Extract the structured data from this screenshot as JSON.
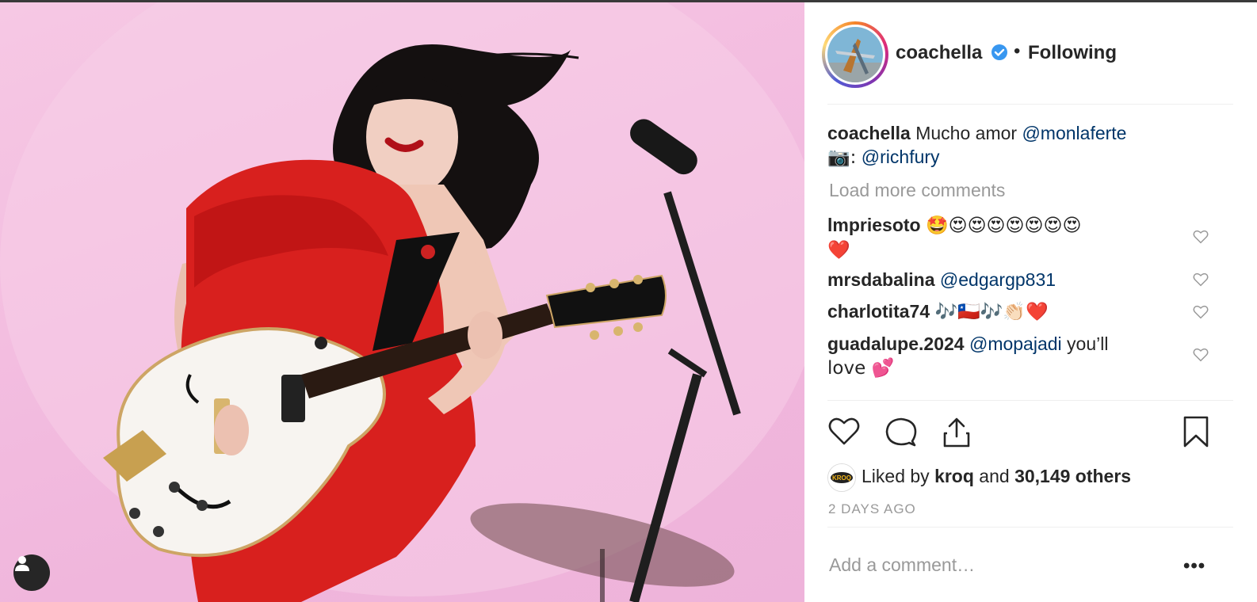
{
  "post": {
    "username": "coachella",
    "following_label": "Following",
    "separator": "•"
  },
  "caption": {
    "username": "coachella",
    "text": "Mucho amor",
    "mention": "@monlaferte",
    "credit_prefix": "📷:",
    "credit_mention": "@richfury"
  },
  "load_more": "Load more comments",
  "comments": [
    {
      "username": "lmpriesoto",
      "text": "🤩😍😍😍😍😍😍😍",
      "text2": "❤️"
    },
    {
      "username": "mrsdabalina",
      "mention": "@edgargp831"
    },
    {
      "username": "charlotita74",
      "text": "🎶🇨🇱🎶👏🏻❤️"
    },
    {
      "username": "guadalupe.2024",
      "mention": "@mopajadi",
      "text": "you’ll",
      "text2": "love 💕"
    }
  ],
  "likes": {
    "prefix": "Liked by",
    "user": "kroq",
    "conjunction": "and",
    "count": "30,149 others",
    "avatar_label": "KROQ"
  },
  "timestamp": "2 DAYS AGO",
  "add_comment_placeholder": "Add a comment…",
  "more_label": "•••",
  "colors": {
    "mention": "#003569",
    "verified": "#3897f0",
    "muted": "#999999",
    "photo_bg": "#f3bde0",
    "dress": "#d8201e"
  },
  "icons": [
    "user-tag-icon",
    "verified-icon",
    "like-heart-icon",
    "comment-icon",
    "share-icon",
    "bookmark-icon",
    "comment-like-icon"
  ]
}
